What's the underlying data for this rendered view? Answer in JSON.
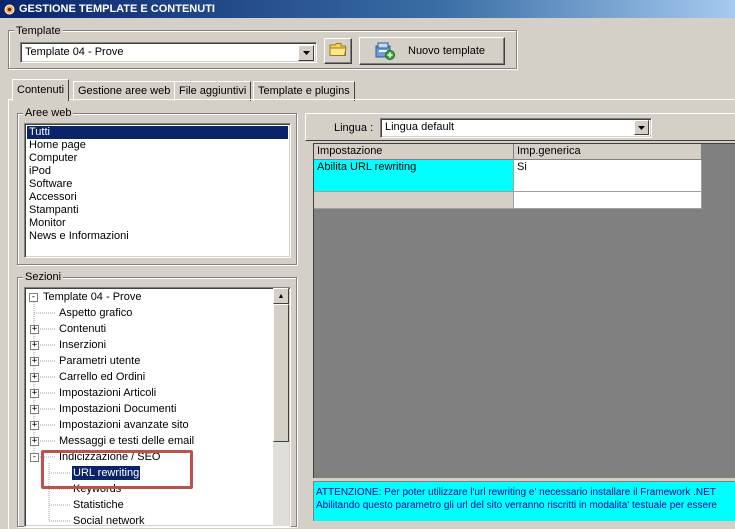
{
  "window": {
    "title": "GESTIONE TEMPLATE E CONTENUTI",
    "icon": "app-gear-icon"
  },
  "template_group": {
    "label": "Template",
    "selected": "Template 04 - Prove",
    "folder_icon": "folder-icon",
    "new_button": "Nuovo template",
    "new_button_icon": "new-template-icon"
  },
  "tabs": [
    {
      "label": "Contenuti",
      "active": true
    },
    {
      "label": "Gestione aree web",
      "active": false
    },
    {
      "label": "File aggiuntivi",
      "active": false
    },
    {
      "label": "Template e plugins",
      "active": false
    }
  ],
  "aree_web": {
    "label": "Aree web",
    "items": [
      "Tutti",
      "Home page",
      "Computer",
      "iPod",
      "Software",
      "Accessori",
      "Stampanti",
      "Monitor",
      "News e Informazioni"
    ],
    "selected_index": 0
  },
  "sezioni": {
    "label": "Sezioni",
    "root": "Template 04 - Prove",
    "items": [
      {
        "label": "Aspetto grafico",
        "level": 1,
        "expandable": false
      },
      {
        "label": "Contenuti",
        "level": 1,
        "expandable": true
      },
      {
        "label": "Inserzioni",
        "level": 1,
        "expandable": true
      },
      {
        "label": "Parametri utente",
        "level": 1,
        "expandable": true
      },
      {
        "label": "Carrello ed Ordini",
        "level": 1,
        "expandable": true
      },
      {
        "label": "Impostazioni Articoli",
        "level": 1,
        "expandable": true
      },
      {
        "label": "Impostazioni Documenti",
        "level": 1,
        "expandable": true
      },
      {
        "label": "Impostazioni avanzate sito",
        "level": 1,
        "expandable": true
      },
      {
        "label": "Messaggi e testi delle email",
        "level": 1,
        "expandable": true
      },
      {
        "label": "Indicizzazione / SEO",
        "level": 1,
        "expandable": true,
        "expanded": true
      },
      {
        "label": "URL rewriting",
        "level": 2,
        "expandable": false,
        "selected": true
      },
      {
        "label": "Keywords",
        "level": 2,
        "expandable": false
      },
      {
        "label": "Statistiche",
        "level": 2,
        "expandable": false
      },
      {
        "label": "Social network",
        "level": 2,
        "expandable": false
      }
    ]
  },
  "lingua": {
    "label": "Lingua :",
    "selected": "Lingua default"
  },
  "grid": {
    "headers": [
      "Impostazione",
      "Imp.generica"
    ],
    "rows": [
      {
        "impostazione": "Abilita URL rewriting",
        "valore": "Si"
      },
      {
        "impostazione": "",
        "valore": ""
      }
    ]
  },
  "notice": {
    "line1": "ATTENZIONE: Per poter utilizzare l'url rewriting e' necessario installare il Framework .NET",
    "line2": "Abilitando questo parametro gli url del sito verranno riscritti in modalita' testuale per essere"
  },
  "colors": {
    "highlight_cell": "#00ffff",
    "selection": "#0a246a",
    "annotation_box": "#c0504d",
    "grid_empty": "#808080"
  }
}
